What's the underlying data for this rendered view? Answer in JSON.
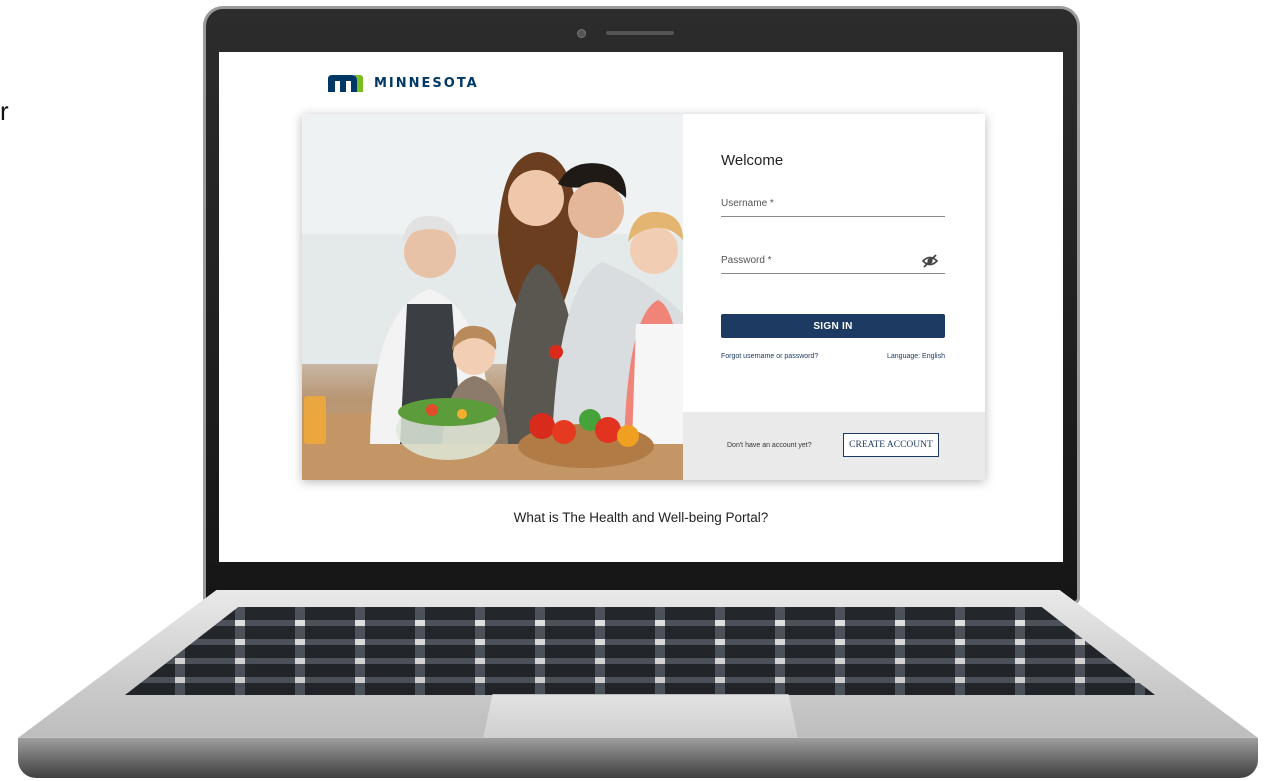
{
  "stray_glyph": "r",
  "header": {
    "logo_text": "MINNESOTA",
    "logo_color": "#003865"
  },
  "login": {
    "welcome": "Welcome",
    "username_label": "Username *",
    "password_label": "Password *",
    "password_toggle_icon": "eye-slash-icon",
    "sign_in_label": "SIGN IN",
    "forgot_link": "Forgot username or password?",
    "language_link": "Language: English",
    "no_account_text": "Don't have an account yet?",
    "create_account_label": "CREATE ACCOUNT",
    "primary_color": "#1d3a63"
  },
  "footer": {
    "what_is_link": "What is The Health and Well-being Portal?"
  }
}
